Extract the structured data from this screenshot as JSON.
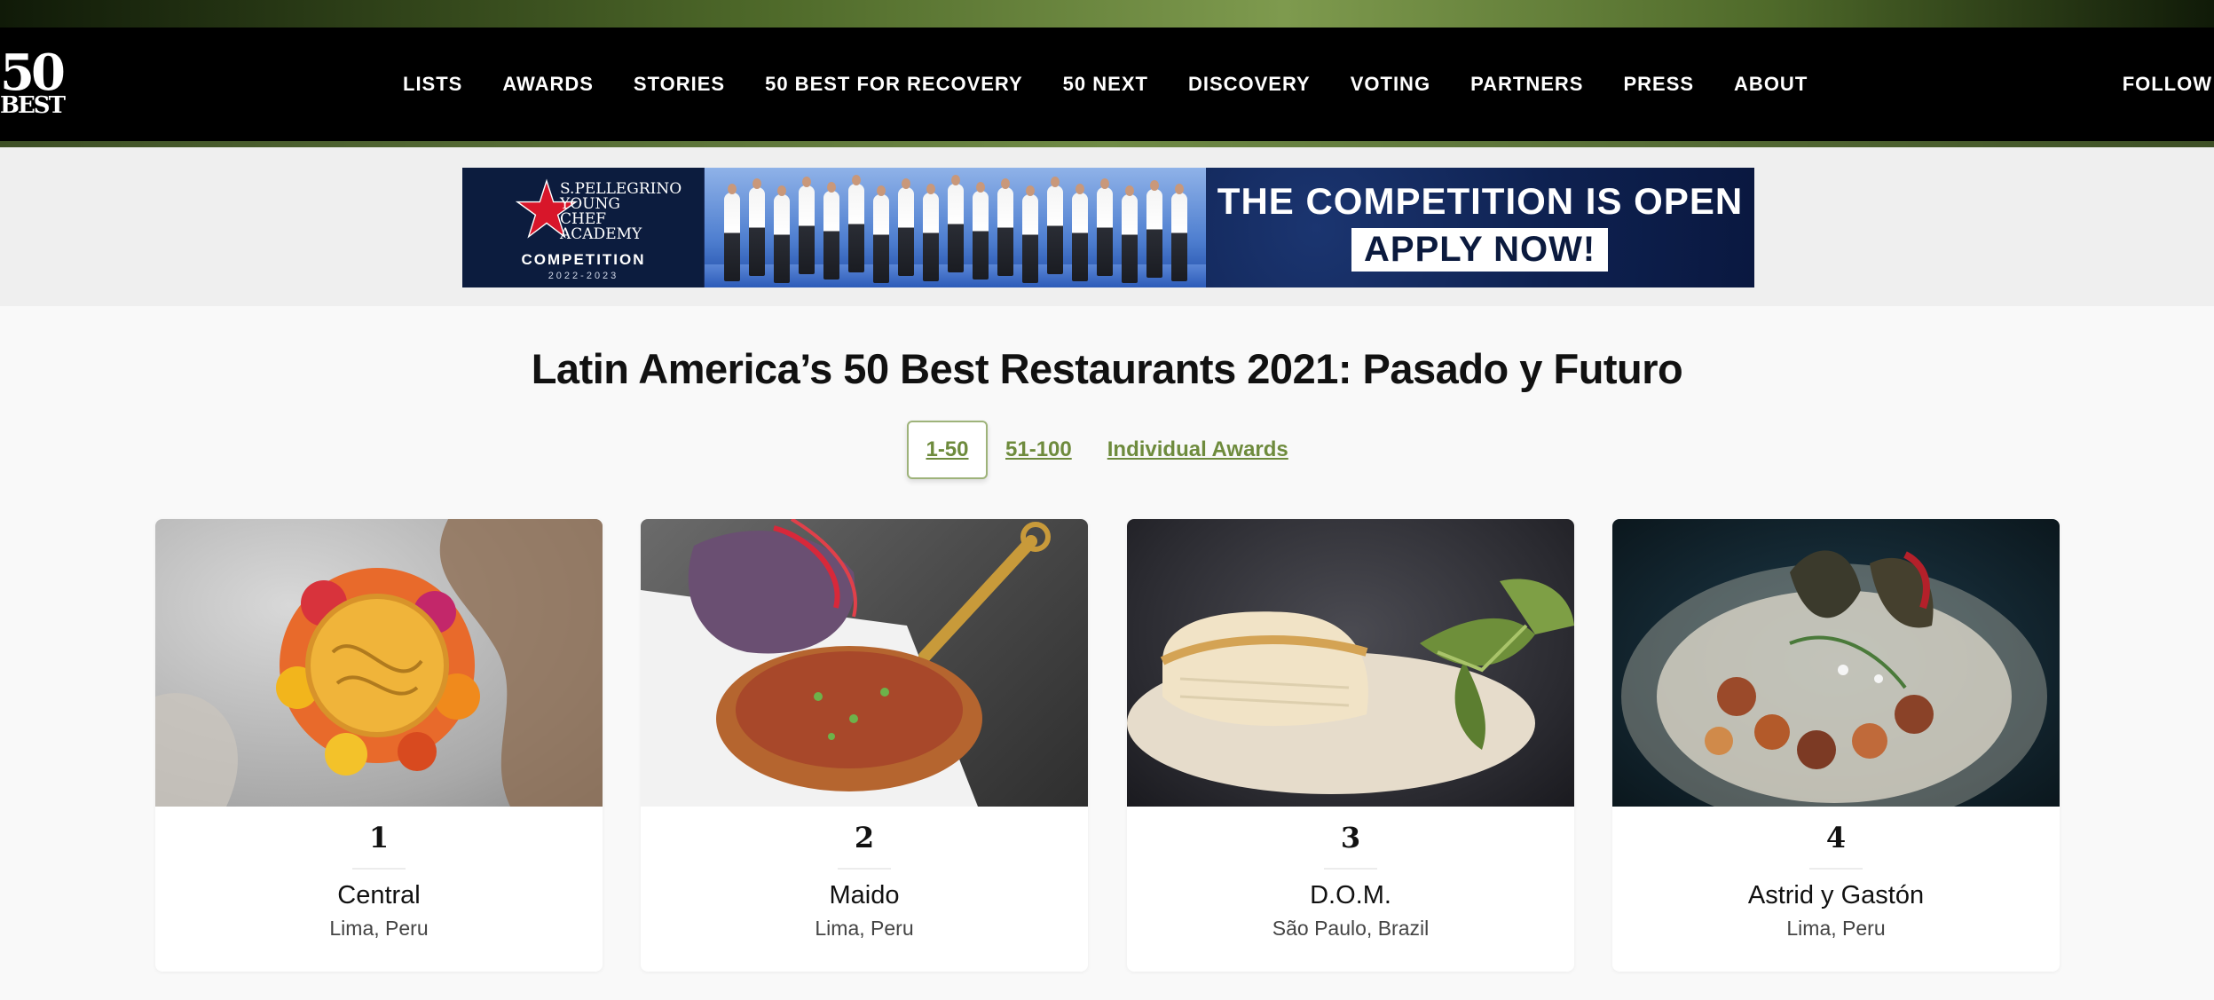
{
  "site": {
    "logo_top": "50",
    "logo_bottom": "BEST"
  },
  "nav": {
    "items": [
      {
        "label": "LISTS"
      },
      {
        "label": "AWARDS"
      },
      {
        "label": "STORIES"
      },
      {
        "label": "50 BEST FOR RECOVERY"
      },
      {
        "label": "50 NEXT"
      },
      {
        "label": "DISCOVERY"
      },
      {
        "label": "VOTING"
      },
      {
        "label": "PARTNERS"
      },
      {
        "label": "PRESS"
      },
      {
        "label": "ABOUT"
      }
    ],
    "follow_label": "FOLLOW"
  },
  "banner": {
    "brand_line1": "S.PELLEGRINO",
    "brand_line2": "YOUNG",
    "brand_line3": "CHEF",
    "brand_line4": "ACADEMY",
    "competition": "COMPETITION",
    "years": "2022-2023",
    "headline": "THE COMPETITION IS OPEN",
    "cta": "APPLY NOW!"
  },
  "page": {
    "title": "Latin America’s 50 Best Restaurants 2021: Pasado y Futuro",
    "tabs": [
      {
        "label": "1-50",
        "active": true
      },
      {
        "label": "51-100",
        "active": false
      },
      {
        "label": "Individual Awards",
        "active": false
      }
    ]
  },
  "restaurants": [
    {
      "rank": "1",
      "name": "Central",
      "location": "Lima, Peru"
    },
    {
      "rank": "2",
      "name": "Maido",
      "location": "Lima, Peru"
    },
    {
      "rank": "3",
      "name": "D.O.M.",
      "location": "São Paulo, Brazil"
    },
    {
      "rank": "4",
      "name": "Astrid y Gastón",
      "location": "Lima, Peru"
    }
  ],
  "colors": {
    "accent_green": "#6e8b3d",
    "nav_bg": "#000000",
    "banner_navy": "#0b1a3e"
  }
}
